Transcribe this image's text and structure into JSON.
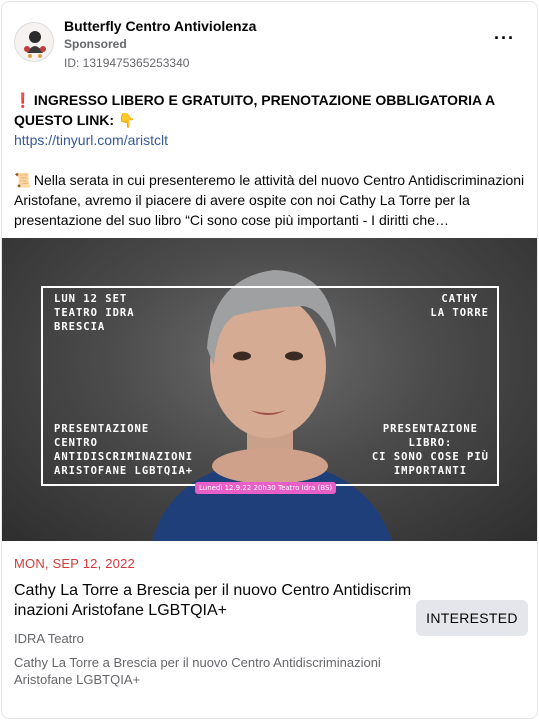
{
  "post": {
    "page_name": "Butterfly Centro Antiviolenza",
    "sponsored": "Sponsored",
    "ad_id": "ID: 1319475365253340",
    "more_icon": "···",
    "line1_emoji": "❗",
    "line1_text": "INGRESSO LIBERO E GRATUITO, PRENOTAZIONE OBBLIGATORIA A QUESTO LINK:",
    "line1_pointer": "👇",
    "link": "https://tinyurl.com/aristclt",
    "para2_emoji": "📜",
    "para2_text": "Nella serata in cui presenteremo le attività del nuovo Centro Antidiscriminazioni Aristofane, avremo il piacere di avere ospite con noi Cathy La Torre per la presentazione del suo libro “Ci sono cose più importanti - I diritti che…"
  },
  "poster": {
    "top_left": "LUN 12 SET\nTEATRO IDRA\nBRESCIA",
    "top_right": "CATHY\nLA TORRE",
    "bottom_left": "PRESENTAZIONE\nCENTRO\nANTIDISCRIMINAZIONI\nARISTOFANE LGBTQIA+",
    "bottom_right": "PRESENTAZIONE\nLIBRO:\nCI SONO COSE PIÙ\nIMPORTANTI",
    "tag": "Lunedì 12.9.22 20h30 Teatro Idra (BS)"
  },
  "event": {
    "date": "MON, SEP 12, 2022",
    "title": "Cathy La Torre a Brescia per il nuovo Centro Antidiscriminazioni Aristofane LGBTQIA+",
    "venue": "IDRA Teatro",
    "description": "Cathy La Torre a Brescia per il nuovo Centro Antidiscriminazioni Aristofane LGBTQIA+",
    "button": "INTERESTED"
  },
  "colors": {
    "date_red": "#d33b3b",
    "link_blue": "#385898",
    "button_bg": "#e4e6eb",
    "poster_tag": "#e85fc7"
  }
}
